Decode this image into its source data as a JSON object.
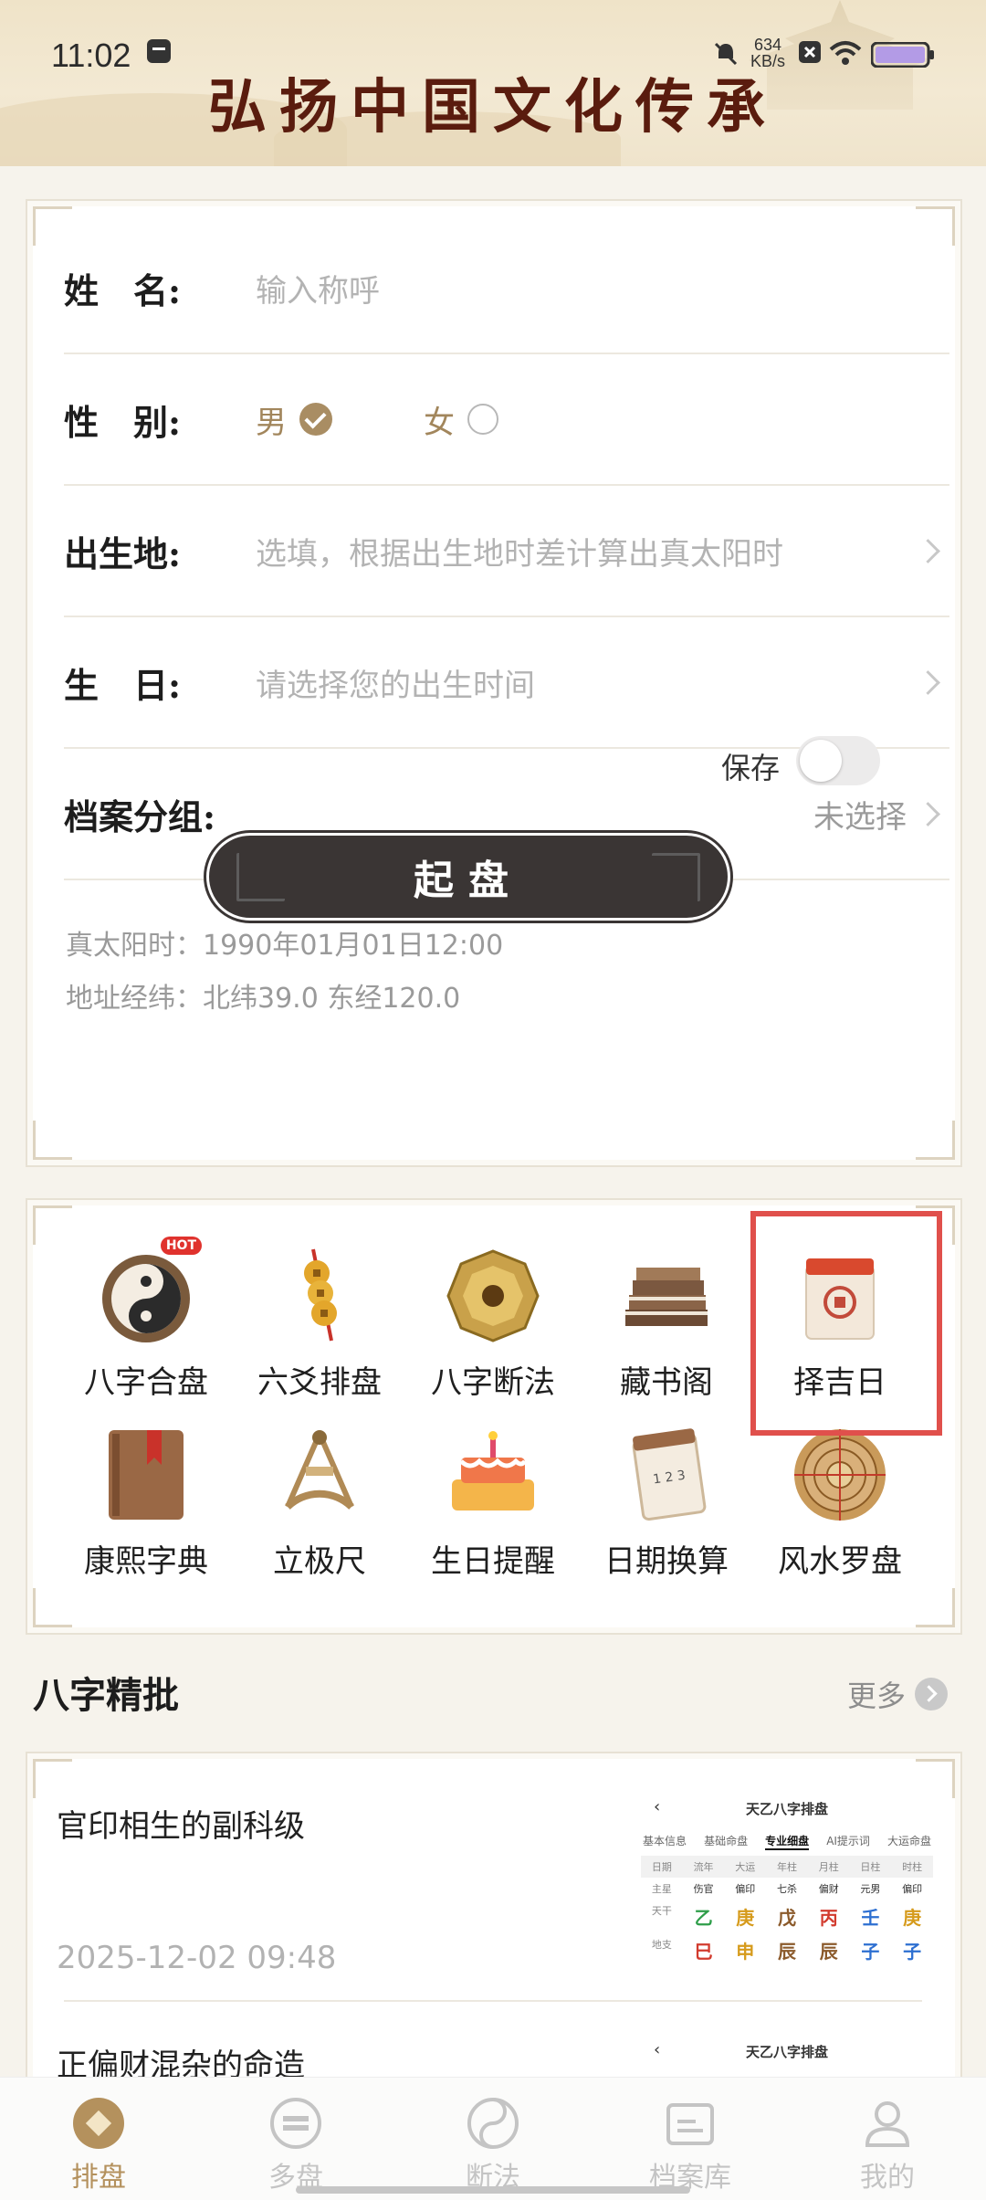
{
  "status_bar": {
    "time": "11:02",
    "net_speed_value": "634",
    "net_speed_unit": "KB/s"
  },
  "banner": {
    "slogan": "弘扬中国文化传承"
  },
  "form": {
    "name_label": "姓　名:",
    "name_placeholder": "输入称呼",
    "gender_label": "性　别:",
    "gender_male": "男",
    "gender_female": "女",
    "gender_selected": "男",
    "birthplace_label": "出生地:",
    "birthplace_placeholder": "选填，根据出生地时差计算出真太阳时",
    "birthday_label": "生　日:",
    "birthday_placeholder": "请选择您的出生时间",
    "group_label": "档案分组:",
    "group_value": "未选择",
    "solar_time": "真太阳时：1990年01月01日12:00",
    "coords": "地址经纬：北纬39.0 东经120.0",
    "save_label": "保存",
    "save_on": false,
    "start_button": "起盘"
  },
  "tools": [
    {
      "label": "八字合盘",
      "icon": "yin-yang-icon",
      "badge": "HOT"
    },
    {
      "label": "六爻排盘",
      "icon": "coins-icon"
    },
    {
      "label": "八字断法",
      "icon": "bagua-icon"
    },
    {
      "label": "藏书阁",
      "icon": "books-icon"
    },
    {
      "label": "择吉日",
      "icon": "calendar-icon",
      "highlighted": true
    },
    {
      "label": "康熙字典",
      "icon": "dictionary-icon"
    },
    {
      "label": "立极尺",
      "icon": "sextant-icon"
    },
    {
      "label": "生日提醒",
      "icon": "cake-icon"
    },
    {
      "label": "日期换算",
      "icon": "date-calendar-icon"
    },
    {
      "label": "风水罗盘",
      "icon": "compass-icon"
    }
  ],
  "section": {
    "title": "八字精批",
    "more": "更多"
  },
  "articles": [
    {
      "title": "官印相生的副科级",
      "date": "2025-12-02 09:48"
    },
    {
      "title": "正偏财混杂的命造"
    }
  ],
  "thumbnail": {
    "title": "天乙八字排盘",
    "tabs": [
      "基本信息",
      "基础命盘",
      "专业细盘",
      "AI提示词",
      "大运命盘"
    ],
    "active_tab": "专业细盘",
    "head_row": [
      "日期",
      "流年",
      "大运",
      "年柱",
      "月柱",
      "日柱",
      "时柱"
    ],
    "row_zhuxing": [
      "主星",
      "伤官",
      "偏印",
      "七杀",
      "偏财",
      "元男",
      "偏印"
    ],
    "row_tiangan": [
      "天干",
      "乙",
      "庚",
      "戊",
      "丙",
      "壬",
      "庚"
    ],
    "row_dizhi": [
      "地支",
      "巳",
      "申",
      "辰",
      "辰",
      "子",
      "子"
    ]
  },
  "nav": [
    {
      "label": "排盘",
      "icon": "paipan-icon",
      "active": true
    },
    {
      "label": "多盘",
      "icon": "duopan-icon"
    },
    {
      "label": "断法",
      "icon": "taiji-icon"
    },
    {
      "label": "档案库",
      "icon": "archive-icon"
    },
    {
      "label": "我的",
      "icon": "profile-icon"
    }
  ],
  "colors": {
    "accent": "#b4915d",
    "highlight": "#e0504c",
    "button": "#3a3534"
  }
}
